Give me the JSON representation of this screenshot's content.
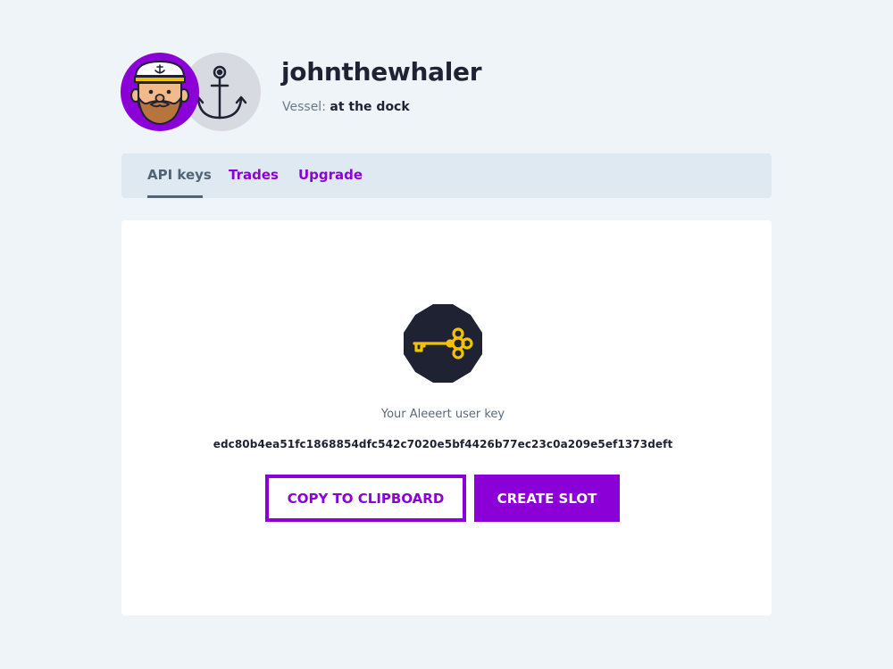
{
  "profile": {
    "username": "johnthewhaler",
    "vessel_label": "Vessel:",
    "vessel_status": "at the dock"
  },
  "tabs": [
    {
      "label": "API keys",
      "active": true
    },
    {
      "label": "Trades",
      "active": false
    },
    {
      "label": "Upgrade",
      "active": false
    }
  ],
  "api_key": {
    "caption": "Your Aleeert user key",
    "value": "edc80b4ea51fc1868854dfc542c7020e5bf4426b77ec23c0a209e5ef1373deft"
  },
  "buttons": {
    "copy_label": "COPY TO CLIPBOARD",
    "create_label": "CREATE SLOT"
  },
  "icons": {
    "avatar": "captain-avatar-icon",
    "vessel": "anchor-icon",
    "api_key": "key-icon"
  },
  "colors": {
    "accent": "#8c00d8",
    "background": "#eff4f8",
    "tab_bar": "#dfe9f2",
    "key_badge": "#1f2233",
    "key_gold": "#f2c200"
  }
}
